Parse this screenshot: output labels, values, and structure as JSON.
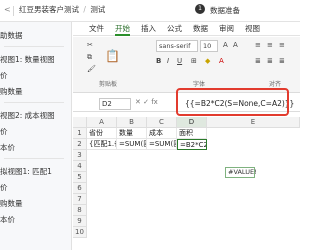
{
  "topbar": {
    "back": "<",
    "breadcrumb": [
      "红豆男装客户测试",
      "/",
      "测试"
    ],
    "step_number": "1",
    "step_label": "数据准备"
  },
  "sidebar": {
    "items": [
      "助数据",
      "视图1: 数量视图",
      "价",
      "购数量",
      "视图2: 成本视图",
      "价",
      "本价",
      "拟视图1: 匹配1",
      "价",
      "购数量",
      "本价"
    ]
  },
  "ribbon": {
    "tabs": [
      "文件",
      "开始",
      "插入",
      "公式",
      "数据",
      "审阅",
      "视图"
    ],
    "active_tab": "开始",
    "font_name": "sans-serif",
    "font_size": "10",
    "clipboard_label": "剪贴板",
    "font_label": "字体",
    "align_label": "对齐"
  },
  "formula": {
    "name_box": "D2",
    "func_icon": "fx",
    "text": "{{=B2*C2(S=None,C=A2)}}"
  },
  "grid": {
    "columns": [
      "A",
      "B",
      "C",
      "D",
      "E"
    ],
    "rows": [
      "1",
      "2",
      "3",
      "4",
      "5",
      "6",
      "7",
      "8",
      "9",
      "10"
    ],
    "cells": {
      "A1": "省份",
      "B1": "数量",
      "C1": "成本",
      "D1": "面积",
      "A2": "{匹配1.省",
      "B2": "=SUM(匹",
      "C2": "=SUM(匹",
      "D2": "=B2*C2"
    },
    "active_cell": "D2",
    "error_tip": "#VALUE!"
  }
}
